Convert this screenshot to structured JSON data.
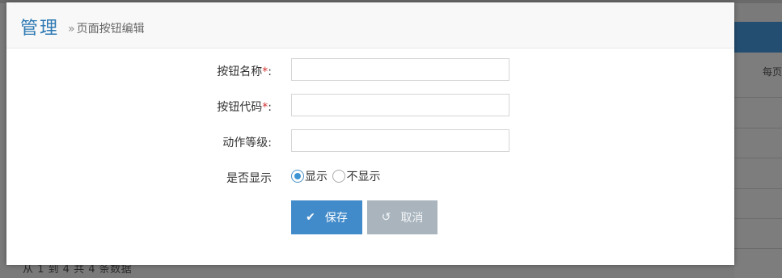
{
  "modal": {
    "title": "管理",
    "subtitle": "页面按钮编辑",
    "breadcrumb_sep": "»"
  },
  "form": {
    "button_name": {
      "label": "按钮名称",
      "required_mark": "*",
      "suffix": ":",
      "value": ""
    },
    "button_code": {
      "label": "按钮代码",
      "required_mark": "*",
      "suffix": ":",
      "value": ""
    },
    "action_level": {
      "label": "动作等级:",
      "value": ""
    },
    "display": {
      "label": "是否显示",
      "options": [
        {
          "label": "显示",
          "checked": true
        },
        {
          "label": "不显示",
          "checked": false
        }
      ]
    }
  },
  "buttons": {
    "save_label": "保存",
    "save_icon": "check-icon",
    "cancel_label": "取消",
    "cancel_icon": "undo-icon"
  },
  "background": {
    "per_page_label": "每页",
    "footer_text": "从 1 到 4 共 4 条数据"
  },
  "colors": {
    "accent": "#428bca",
    "title": "#2e79b3",
    "required": "#d12f2f",
    "cancel": "#a9b4bd"
  }
}
